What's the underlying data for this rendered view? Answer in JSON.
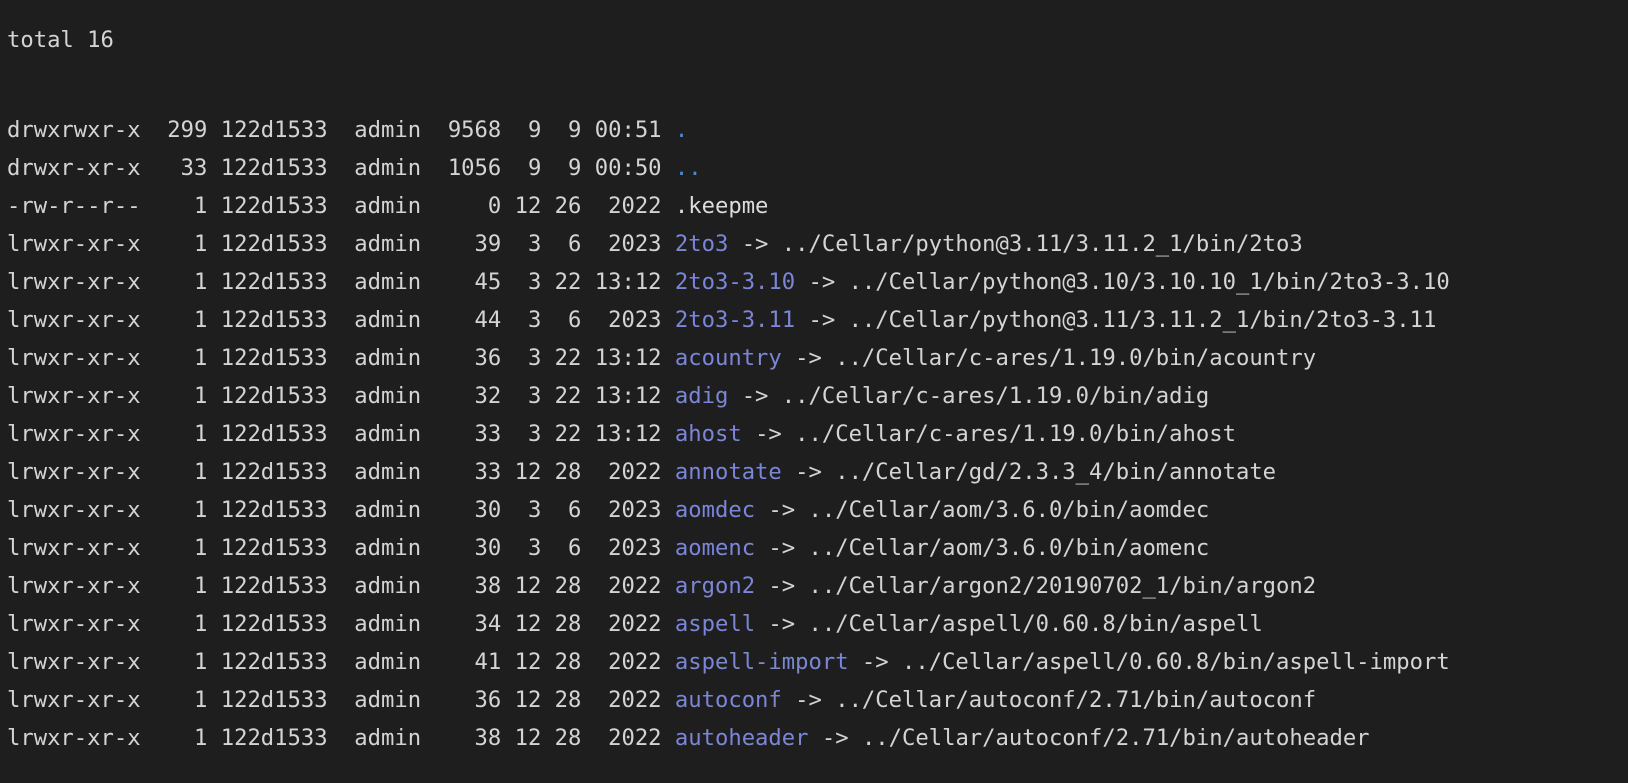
{
  "total_line": "total 16",
  "entries": [
    {
      "meta": "drwxrwxr-x  299 122d1533  admin  9568  9  9 00:51",
      "name": ".",
      "type": "dir",
      "target": ""
    },
    {
      "meta": "drwxr-xr-x   33 122d1533  admin  1056  9  9 00:50",
      "name": "..",
      "type": "dir",
      "target": ""
    },
    {
      "meta": "-rw-r--r--    1 122d1533  admin     0 12 26  2022",
      "name": ".keepme",
      "type": "file",
      "target": ""
    },
    {
      "meta": "lrwxr-xr-x    1 122d1533  admin    39  3  6  2023",
      "name": "2to3",
      "type": "link",
      "target": "../Cellar/python@3.11/3.11.2_1/bin/2to3"
    },
    {
      "meta": "lrwxr-xr-x    1 122d1533  admin    45  3 22 13:12",
      "name": "2to3-3.10",
      "type": "link",
      "target": "../Cellar/python@3.10/3.10.10_1/bin/2to3-3.10"
    },
    {
      "meta": "lrwxr-xr-x    1 122d1533  admin    44  3  6  2023",
      "name": "2to3-3.11",
      "type": "link",
      "target": "../Cellar/python@3.11/3.11.2_1/bin/2to3-3.11"
    },
    {
      "meta": "lrwxr-xr-x    1 122d1533  admin    36  3 22 13:12",
      "name": "acountry",
      "type": "link",
      "target": "../Cellar/c-ares/1.19.0/bin/acountry"
    },
    {
      "meta": "lrwxr-xr-x    1 122d1533  admin    32  3 22 13:12",
      "name": "adig",
      "type": "link",
      "target": "../Cellar/c-ares/1.19.0/bin/adig"
    },
    {
      "meta": "lrwxr-xr-x    1 122d1533  admin    33  3 22 13:12",
      "name": "ahost",
      "type": "link",
      "target": "../Cellar/c-ares/1.19.0/bin/ahost"
    },
    {
      "meta": "lrwxr-xr-x    1 122d1533  admin    33 12 28  2022",
      "name": "annotate",
      "type": "link",
      "target": "../Cellar/gd/2.3.3_4/bin/annotate"
    },
    {
      "meta": "lrwxr-xr-x    1 122d1533  admin    30  3  6  2023",
      "name": "aomdec",
      "type": "link",
      "target": "../Cellar/aom/3.6.0/bin/aomdec"
    },
    {
      "meta": "lrwxr-xr-x    1 122d1533  admin    30  3  6  2023",
      "name": "aomenc",
      "type": "link",
      "target": "../Cellar/aom/3.6.0/bin/aomenc"
    },
    {
      "meta": "lrwxr-xr-x    1 122d1533  admin    38 12 28  2022",
      "name": "argon2",
      "type": "link",
      "target": "../Cellar/argon2/20190702_1/bin/argon2"
    },
    {
      "meta": "lrwxr-xr-x    1 122d1533  admin    34 12 28  2022",
      "name": "aspell",
      "type": "link",
      "target": "../Cellar/aspell/0.60.8/bin/aspell"
    },
    {
      "meta": "lrwxr-xr-x    1 122d1533  admin    41 12 28  2022",
      "name": "aspell-import",
      "type": "link",
      "target": "../Cellar/aspell/0.60.8/bin/aspell-import"
    },
    {
      "meta": "lrwxr-xr-x    1 122d1533  admin    36 12 28  2022",
      "name": "autoconf",
      "type": "link",
      "target": "../Cellar/autoconf/2.71/bin/autoconf"
    },
    {
      "meta": "lrwxr-xr-x    1 122d1533  admin    38 12 28  2022",
      "name": "autoheader",
      "type": "link",
      "target": "../Cellar/autoconf/2.71/bin/autoheader"
    }
  ],
  "arrow_text": "->",
  "colors": {
    "background": "#1e1e1e",
    "text": "#d4d4d4",
    "directory": "#3b8eea",
    "symlink": "#7b86d6"
  }
}
